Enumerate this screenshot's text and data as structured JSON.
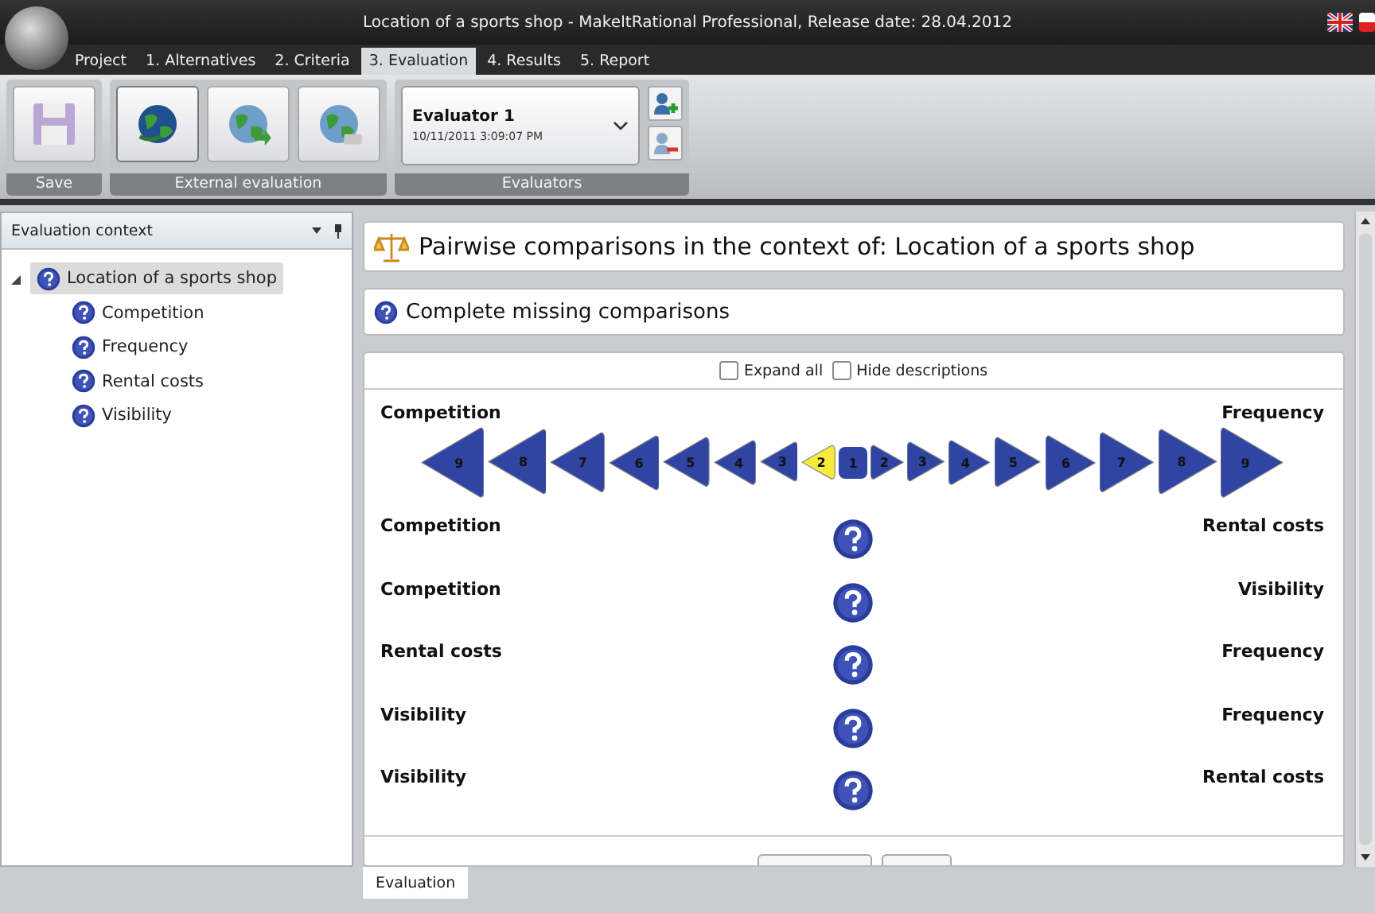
{
  "window": {
    "title": "Location of a sports shop - MakeItRational Professional, Release date: 28.04.2012"
  },
  "menu_tabs": [
    {
      "label": "Project",
      "selected": false
    },
    {
      "label": "1. Alternatives",
      "selected": false
    },
    {
      "label": "2. Criteria",
      "selected": false
    },
    {
      "label": "3. Evaluation",
      "selected": true
    },
    {
      "label": "4. Results",
      "selected": false
    },
    {
      "label": "5. Report",
      "selected": false
    }
  ],
  "ribbon": {
    "groups": [
      {
        "label": "Save",
        "kind": "save"
      },
      {
        "label": "External evaluation",
        "kind": "external"
      },
      {
        "label": "Evaluators",
        "kind": "evaluators"
      }
    ],
    "evaluator": {
      "name": "Evaluator 1",
      "date": "10/11/2011 3:09:07 PM"
    }
  },
  "sidebar": {
    "title": "Evaluation context",
    "tree": [
      {
        "label": "Location of a sports shop",
        "selected": true,
        "expanded": true,
        "children": [
          {
            "label": "Competition",
            "selected": false
          },
          {
            "label": "Frequency",
            "selected": false
          },
          {
            "label": "Rental costs",
            "selected": false
          },
          {
            "label": "Visibility",
            "selected": false
          }
        ]
      }
    ]
  },
  "header": {
    "title": "Pairwise comparisons in the context of: Location of a sports shop"
  },
  "action": {
    "label": "Complete missing comparisons"
  },
  "options": [
    {
      "label": "Expand all",
      "checked": false
    },
    {
      "label": "Hide descriptions",
      "checked": false
    }
  ],
  "comparisons": [
    {
      "kind": "scale",
      "left": "Competition",
      "right": "Frequency",
      "scale": [
        {
          "label": "9",
          "kind": "left",
          "selected": false
        },
        {
          "label": "8",
          "kind": "left",
          "selected": false
        },
        {
          "label": "7",
          "kind": "left",
          "selected": false
        },
        {
          "label": "6",
          "kind": "left",
          "selected": false
        },
        {
          "label": "5",
          "kind": "left",
          "selected": false
        },
        {
          "label": "4",
          "kind": "left",
          "selected": false
        },
        {
          "label": "3",
          "kind": "left",
          "selected": false
        },
        {
          "label": "2",
          "kind": "left",
          "selected": true
        },
        {
          "label": "1",
          "kind": "equal",
          "selected": false
        },
        {
          "label": "2",
          "kind": "right",
          "selected": false
        },
        {
          "label": "3",
          "kind": "right",
          "selected": false
        },
        {
          "label": "4",
          "kind": "right",
          "selected": false
        },
        {
          "label": "5",
          "kind": "right",
          "selected": false
        },
        {
          "label": "6",
          "kind": "right",
          "selected": false
        },
        {
          "label": "7",
          "kind": "right",
          "selected": false
        },
        {
          "label": "8",
          "kind": "right",
          "selected": false
        },
        {
          "label": "9",
          "kind": "right",
          "selected": false
        }
      ]
    },
    {
      "kind": "missing",
      "left": "Competition",
      "right": "Rental costs"
    },
    {
      "kind": "missing",
      "left": "Competition",
      "right": "Visibility"
    },
    {
      "kind": "missing",
      "left": "Rental costs",
      "right": "Frequency"
    },
    {
      "kind": "missing",
      "left": "Visibility",
      "right": "Frequency"
    },
    {
      "kind": "missing",
      "left": "Visibility",
      "right": "Rental costs"
    }
  ],
  "bottom_tabs": [
    {
      "label": "Evaluation",
      "selected": true
    }
  ]
}
